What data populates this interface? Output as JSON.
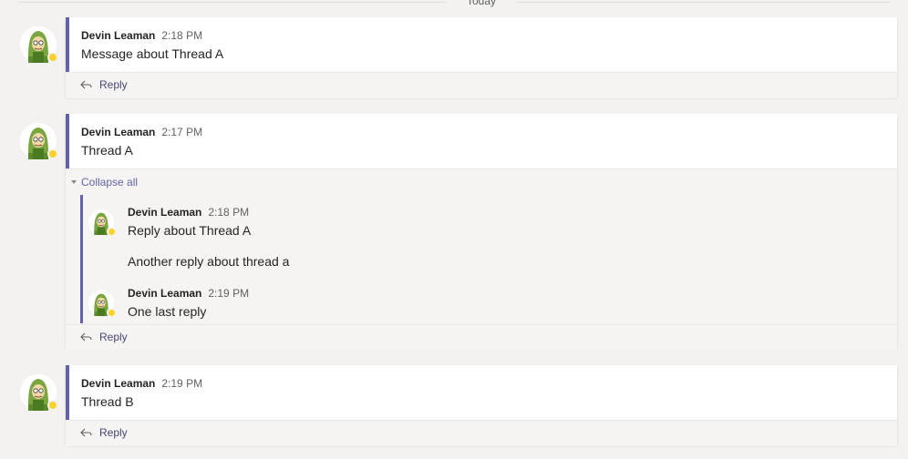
{
  "date_divider": {
    "label": "Today"
  },
  "colors": {
    "accent": "#6264a7",
    "presence_away": "#f8d22a"
  },
  "messages": [
    {
      "author": "Devin Leaman",
      "time": "2:18 PM",
      "text": "Message about Thread A",
      "reply_label": "Reply"
    },
    {
      "author": "Devin Leaman",
      "time": "2:17 PM",
      "text": "Thread A",
      "collapse_label": "Collapse all",
      "replies": [
        {
          "author": "Devin Leaman",
          "time": "2:18 PM",
          "text": "Reply about Thread A",
          "extra": "Another reply about thread a"
        },
        {
          "author": "Devin Leaman",
          "time": "2:19 PM",
          "text": "One last reply"
        }
      ],
      "reply_label": "Reply"
    },
    {
      "author": "Devin Leaman",
      "time": "2:19 PM",
      "text": "Thread B",
      "reply_label": "Reply"
    }
  ],
  "icons": {
    "avatar": "cartoon-avatar-icon",
    "presence": "away-presence-icon",
    "reply": "reply-arrow-icon",
    "collapse": "chevron-down-icon"
  }
}
